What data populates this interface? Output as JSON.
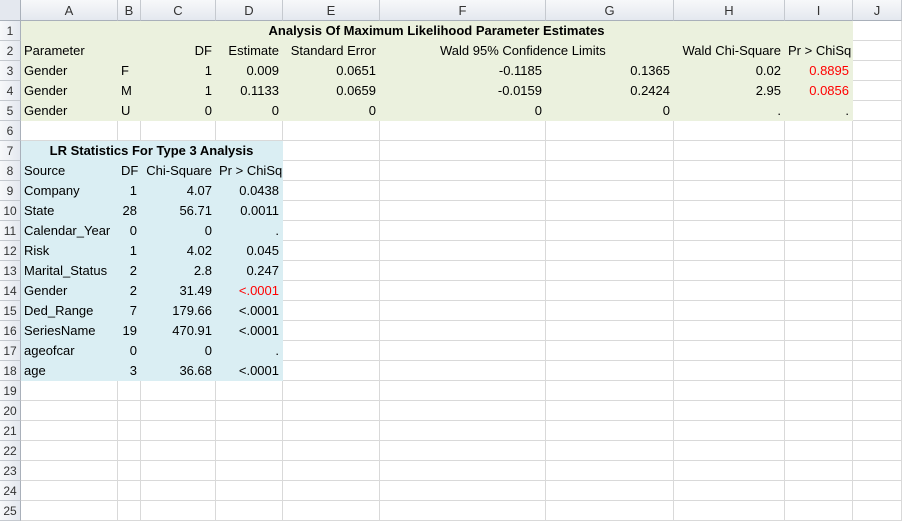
{
  "columns": [
    "A",
    "B",
    "C",
    "D",
    "E",
    "F",
    "G",
    "H",
    "I",
    "J"
  ],
  "rows": [
    "1",
    "2",
    "3",
    "4",
    "5",
    "6",
    "7",
    "8",
    "9",
    "10",
    "11",
    "12",
    "13",
    "14",
    "15",
    "16",
    "17",
    "18",
    "19",
    "20",
    "21",
    "22",
    "23",
    "24",
    "25"
  ],
  "mle": {
    "title": "Analysis Of Maximum Likelihood Parameter Estimates",
    "headers": {
      "parameter": "Parameter",
      "df": "DF",
      "estimate": "Estimate",
      "std_error": "Standard Error",
      "wald_limits": "Wald 95% Confidence Limits",
      "wald_chisq": "Wald Chi-Square",
      "pr_chisq": "Pr > ChiSq"
    },
    "rows": [
      {
        "parameter": "Gender",
        "level": "F",
        "df": "1",
        "estimate": "0.009",
        "std_error": "0.0651",
        "lower": "-0.1185",
        "upper": "0.1365",
        "chisq": "0.02",
        "p": "0.8895"
      },
      {
        "parameter": "Gender",
        "level": "M",
        "df": "1",
        "estimate": "0.1133",
        "std_error": "0.0659",
        "lower": "-0.0159",
        "upper": "0.2424",
        "chisq": "2.95",
        "p": "0.0856"
      },
      {
        "parameter": "Gender",
        "level": "U",
        "df": "0",
        "estimate": "0",
        "std_error": "0",
        "lower": "0",
        "upper": "0",
        "chisq": ".",
        "p": "."
      }
    ]
  },
  "lr": {
    "title": "LR Statistics For Type 3 Analysis",
    "headers": {
      "source": "Source",
      "df": "DF",
      "chisq": "Chi-Square",
      "p": "Pr > ChiSq"
    },
    "rows": [
      {
        "source": "Company",
        "df": "1",
        "chisq": "4.07",
        "p": "0.0438"
      },
      {
        "source": "State",
        "df": "28",
        "chisq": "56.71",
        "p": "0.0011"
      },
      {
        "source": "Calendar_Year",
        "df": "0",
        "chisq": "0",
        "p": "."
      },
      {
        "source": "Risk",
        "df": "1",
        "chisq": "4.02",
        "p": "0.045"
      },
      {
        "source": "Marital_Status",
        "df": "2",
        "chisq": "2.8",
        "p": "0.247"
      },
      {
        "source": "Gender",
        "df": "2",
        "chisq": "31.49",
        "p": "<.0001"
      },
      {
        "source": "Ded_Range",
        "df": "7",
        "chisq": "179.66",
        "p": "<.0001"
      },
      {
        "source": "SeriesName",
        "df": "19",
        "chisq": "470.91",
        "p": "<.0001"
      },
      {
        "source": "ageofcar",
        "df": "0",
        "chisq": "0",
        "p": "."
      },
      {
        "source": "age",
        "df": "3",
        "chisq": "36.68",
        "p": "<.0001"
      }
    ]
  },
  "colors": {
    "mle_fill": "#ebf1de",
    "lr_fill": "#daeef3",
    "highlight": "#ff0000"
  }
}
